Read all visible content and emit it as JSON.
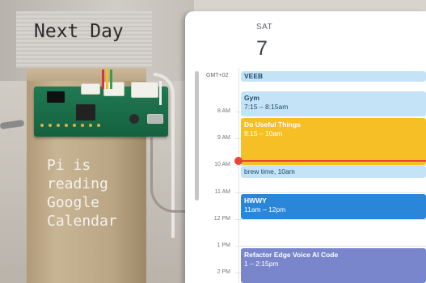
{
  "overlay": {
    "top_label": "Next Day",
    "caption_lines": [
      "Pi is",
      "reading",
      "Google",
      "Calendar"
    ]
  },
  "calendar": {
    "day_name": "SAT",
    "day_number": "7",
    "timezone": "GMT+02",
    "hours": [
      "8 AM",
      "9 AM",
      "10 AM",
      "11 AM",
      "12 PM",
      "1 PM",
      "2 PM"
    ],
    "all_day_event": "VEEB",
    "events": [
      {
        "title": "Gym",
        "time": "7:15 – 8:15am",
        "color": "#c5e3f6",
        "text_color": "#1a4a6b"
      },
      {
        "title": "Do Useful Things",
        "time": "8:15 – 10am",
        "color": "#f6bf26",
        "text_color": "#ffffff"
      },
      {
        "title": "brew time, 10am",
        "time": "",
        "color": "#c5e3f6",
        "text_color": "#1a4a6b"
      },
      {
        "title": "HWWY",
        "time": "11am – 12pm",
        "color": "#2b86d9",
        "text_color": "#ffffff"
      },
      {
        "title": "Refactor Edge Voice AI Code",
        "time": "1 – 2:15pm",
        "color": "#7986cb",
        "text_color": "#ffffff"
      }
    ]
  },
  "colors": {
    "now_indicator": "#ea4335",
    "board_green": "#1f7a52",
    "cardboard": "#c8b594"
  }
}
